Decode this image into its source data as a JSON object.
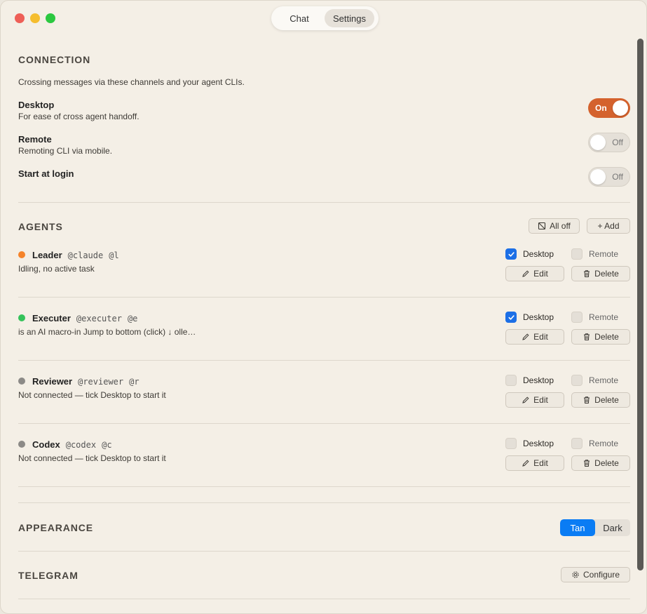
{
  "tabs": {
    "chat": "Chat",
    "settings": "Settings"
  },
  "connection": {
    "title": "CONNECTION",
    "description": "Crossing messages via these channels and your agent CLIs.",
    "items": [
      {
        "title": "Desktop",
        "subtitle": "For ease of cross agent handoff.",
        "toggle": "On"
      },
      {
        "title": "Remote",
        "subtitle": "Remoting CLI via mobile.",
        "toggle": "Off"
      },
      {
        "title": "Start at login",
        "subtitle": "",
        "toggle": "Off"
      }
    ]
  },
  "agents": {
    "title": "AGENTS",
    "all_off_label": "All off",
    "add_label": "+ Add",
    "desktop_label": "Desktop",
    "remote_label": "Remote",
    "edit_label": "Edit",
    "delete_label": "Delete",
    "list": [
      {
        "name": "Leader",
        "handle": "@claude",
        "short": "@l",
        "status": "Idling, no active task",
        "dot_color": "#f5832a",
        "desktop": true,
        "remote": false
      },
      {
        "name": "Executer",
        "handle": "@executer",
        "short": "@e",
        "status": "is an AI macro-in Jump to bottom (click) ↓ olle…",
        "dot_color": "#34c25a",
        "desktop": true,
        "remote": false
      },
      {
        "name": "Reviewer",
        "handle": "@reviewer",
        "short": "@r",
        "status": "Not connected — tick Desktop to start it",
        "dot_color": "#8c8a87",
        "desktop": false,
        "remote": false
      },
      {
        "name": "Codex",
        "handle": "@codex",
        "short": "@c",
        "status": "Not connected — tick Desktop to start it",
        "dot_color": "#8c8a87",
        "desktop": false,
        "remote": false
      }
    ]
  },
  "appearance": {
    "title": "APPEARANCE",
    "options": [
      "Tan",
      "Dark"
    ],
    "selected": "Tan"
  },
  "telegram": {
    "title": "TELEGRAM",
    "configure_label": "Configure"
  },
  "colors": {
    "accent_toggle": "#d4622d",
    "accent_blue": "#0a7cf4",
    "background": "#f4efe6"
  }
}
